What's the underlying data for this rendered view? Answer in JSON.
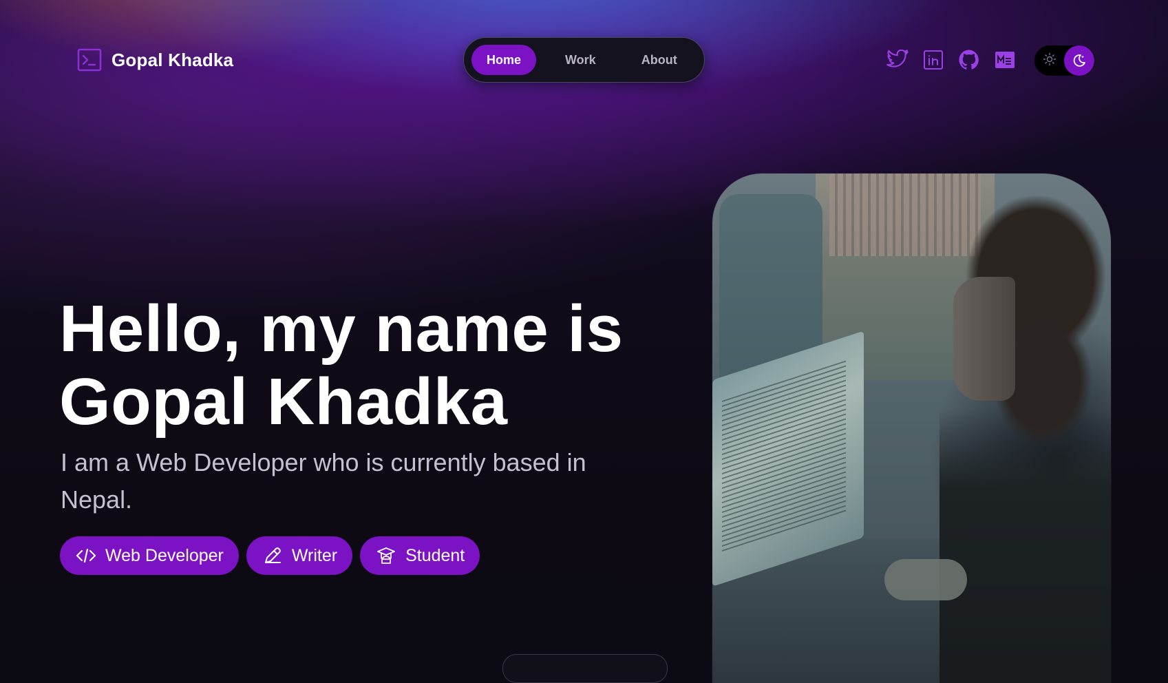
{
  "brand": {
    "name": "Gopal Khadka",
    "icon": "terminal-icon"
  },
  "nav": {
    "items": [
      {
        "label": "Home",
        "active": true
      },
      {
        "label": "Work",
        "active": false
      },
      {
        "label": "About",
        "active": false
      }
    ]
  },
  "socials": [
    {
      "icon": "twitter-icon"
    },
    {
      "icon": "linkedin-icon"
    },
    {
      "icon": "github-icon"
    },
    {
      "icon": "medium-icon"
    }
  ],
  "theme_toggle": {
    "mode": "dark",
    "icons": [
      "sun-icon",
      "moon-icon"
    ]
  },
  "hero": {
    "title_line1": "Hello, my name is",
    "title_line2": "Gopal Khadka",
    "subtitle": "I am a Web Developer who is currently based in Nepal.",
    "tags": [
      {
        "label": "Web Developer",
        "icon": "code-icon"
      },
      {
        "label": "Writer",
        "icon": "pencil-icon"
      },
      {
        "label": "Student",
        "icon": "graduation-icon"
      }
    ]
  },
  "colors": {
    "accent": "#7b12c4",
    "background": "#0c0a12",
    "text": "#ffffff",
    "muted_text": "#c5c2cf"
  }
}
